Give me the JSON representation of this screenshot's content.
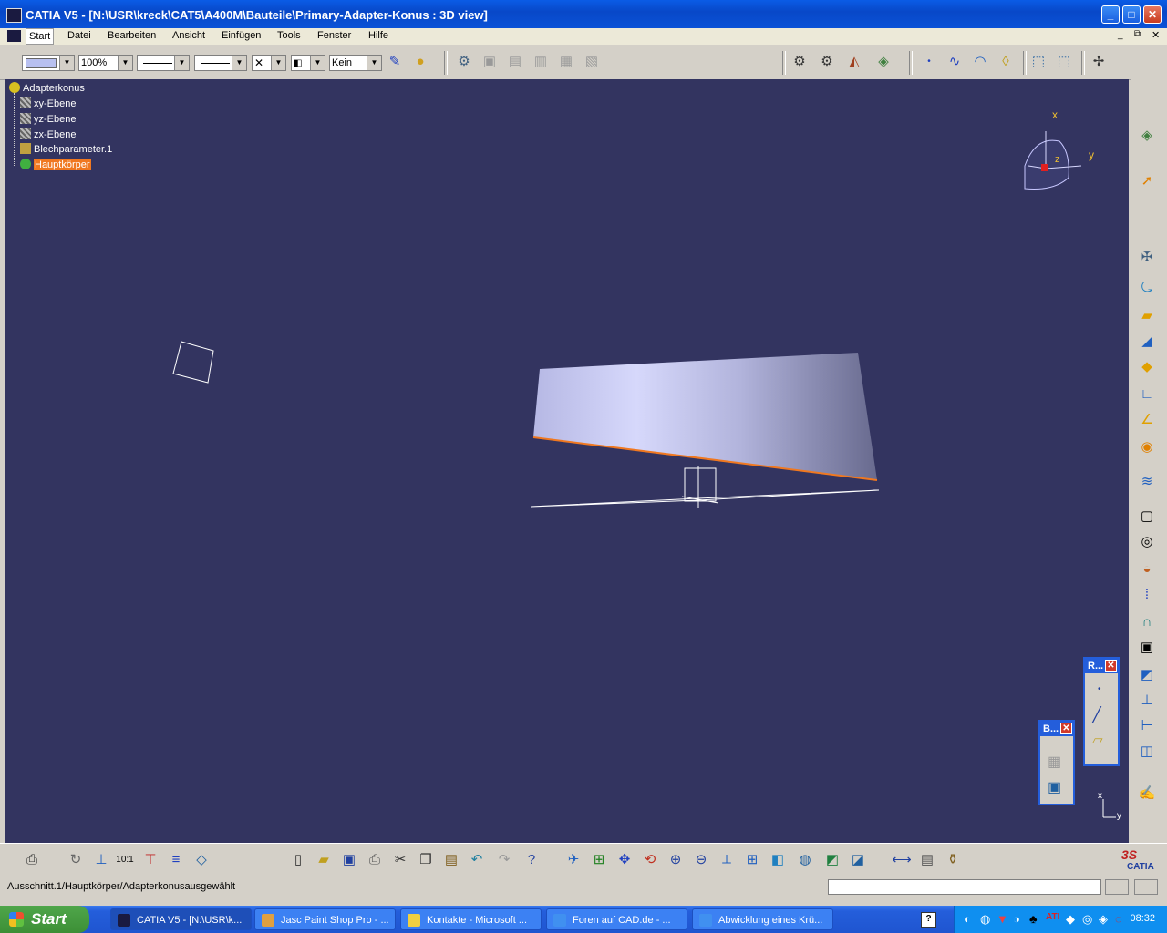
{
  "window": {
    "title": "CATIA V5 - [N:\\USR\\kreck\\CAT5\\A400M\\Bauteile\\Primary-Adapter-Konus : 3D view]",
    "minimize": "_",
    "maximize": "□",
    "close": "✕"
  },
  "menu": {
    "items": [
      "Start",
      "Datei",
      "Bearbeiten",
      "Ansicht",
      "Einfügen",
      "Tools",
      "Fenster",
      "Hilfe"
    ]
  },
  "toolbar": {
    "zoom_value": "100%",
    "layer_value": "Kein",
    "colors": {
      "fill": "#b8c0f0",
      "bg": "#d4d0c8"
    }
  },
  "tree": {
    "root": "Adapterkonus",
    "items": [
      "xy-Ebene",
      "yz-Ebene",
      "zx-Ebene",
      "Blechparameter.1",
      "Hauptkörper"
    ]
  },
  "compass": {
    "x": "x",
    "y": "y",
    "z": "z"
  },
  "axes_corner": {
    "x": "x",
    "y": "y"
  },
  "floating": {
    "r_title": "R...",
    "b_title": "B..."
  },
  "status": {
    "message": "Ausschnitt.1/Hauptkörper/Adapterkonusausgewählt"
  },
  "brand": "CATIA",
  "taskbar": {
    "start": "Start",
    "tasks": [
      "CATIA V5 - [N:\\USR\\k...",
      "Jasc Paint Shop Pro - ...",
      "Kontakte - Microsoft ...",
      "Foren auf CAD.de - ...",
      "Abwicklung eines Krü..."
    ],
    "clock": "08:32"
  },
  "colors": {
    "viewport_bg": "#333460",
    "selection": "#f07820",
    "taskbar": "#245edb"
  }
}
